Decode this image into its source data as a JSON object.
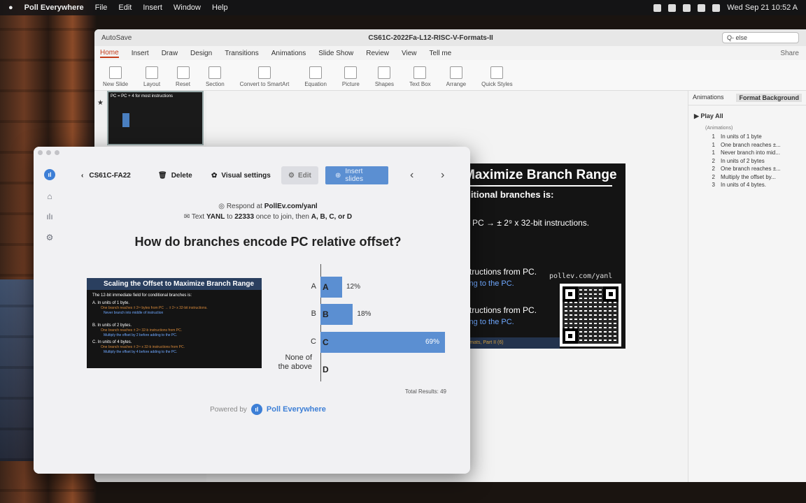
{
  "menubar": {
    "app_name": "Poll Everywhere",
    "menus": [
      "File",
      "Edit",
      "Insert",
      "Window",
      "Help"
    ],
    "clock": "Wed Sep 21  10:52 A"
  },
  "powerpoint": {
    "autosave": "AutoSave",
    "doc_title": "CS61C-2022Fa-L12-RISC-V-Formats-II",
    "search_placeholder": "Q- else",
    "tabs": [
      "Home",
      "Insert",
      "Draw",
      "Design",
      "Transitions",
      "Animations",
      "Slide Show",
      "Review",
      "View",
      "Tell me"
    ],
    "active_tab": "Home",
    "share_label": "Share",
    "ribbon_items": [
      "New Slide",
      "Layout",
      "Reset",
      "Section",
      "Convert to SmartArt",
      "Equation",
      "Picture",
      "Shapes",
      "Text Box",
      "Arrange",
      "Quick Styles"
    ],
    "thumbnail_title": "PC = PC + 4 for most instructions",
    "slide": {
      "title": "Maximize Branch Range",
      "subtitle": "ditional branches is:",
      "line1": "n PC → ± 2⁹ x 32-bit instructions.",
      "line2": "structions from PC.",
      "blue1": "ting to the PC.",
      "line3": "structions from PC.",
      "blue2": "ting to the PC.",
      "url": "pollev.com/yanl",
      "footer": "rmats, Part II (6)"
    },
    "animation_pane": {
      "tab_animations": "Animations",
      "tab_format": "Format Background",
      "play_all": "Play All",
      "section": "(Animations)",
      "items": [
        {
          "num": "1",
          "label": "In units of 1 byte"
        },
        {
          "num": "1",
          "label": "One branch reaches ±..."
        },
        {
          "num": "1",
          "label": "Never branch into mid..."
        },
        {
          "num": "2",
          "label": "In units of 2 bytes"
        },
        {
          "num": "2",
          "label": "One branch reaches ±..."
        },
        {
          "num": "2",
          "label": "Multiply the offset by..."
        },
        {
          "num": "3",
          "label": "In units of 4 bytes."
        }
      ]
    }
  },
  "pollev": {
    "back_label": "CS61C-FA22",
    "delete_label": "Delete",
    "visual_settings_label": "Visual settings",
    "edit_label": "Edit",
    "insert_slides_label": "Insert slides",
    "respond_prefix": "Respond at ",
    "respond_url": "PollEv.com/yanl",
    "text_prefix": "Text ",
    "text_code": "YANL",
    "text_to": " to ",
    "text_number": "22333",
    "text_suffix": " once to join, then ",
    "text_options": "A, B, C, or D",
    "question": "How do branches encode PC relative offset?",
    "total_results": "Total Results: 49",
    "powered_by": "Powered by",
    "brand": "Poll Everywhere",
    "mini_slide": {
      "title": "Scaling the Offset to Maximize Branch Range",
      "intro": "The 12-bit immediate field for conditional branches is:",
      "a": "A. In units of 1 byte.",
      "a_detail": "One branch reaches ± 2¹¹ bytes from PC → ± 2⁹ x 32-bit instructions.",
      "a_note": "Never branch into middle of instruction",
      "b": "B. In units of 2 bytes.",
      "b_detail": "One branch reaches ± 2¹¹ 32-b instructions from PC.",
      "b_note": "Multiply the offset by 2 before adding to the PC.",
      "c": "C. In units of 4 bytes.",
      "c_detail": "One branch reaches ± 2¹¹ x 32-b instructions from PC.",
      "c_note": "Multiply the offset by 4 before adding to the PC."
    }
  },
  "chart_data": {
    "type": "bar",
    "orientation": "horizontal",
    "categories": [
      "A",
      "B",
      "C",
      "None of the above"
    ],
    "bar_letters": [
      "A",
      "B",
      "C",
      "D"
    ],
    "values": [
      12,
      18,
      69,
      0
    ],
    "value_labels": [
      "12%",
      "18%",
      "69%",
      ""
    ],
    "unit": "%",
    "xlim": [
      0,
      100
    ],
    "color": "#5b8fd2"
  }
}
